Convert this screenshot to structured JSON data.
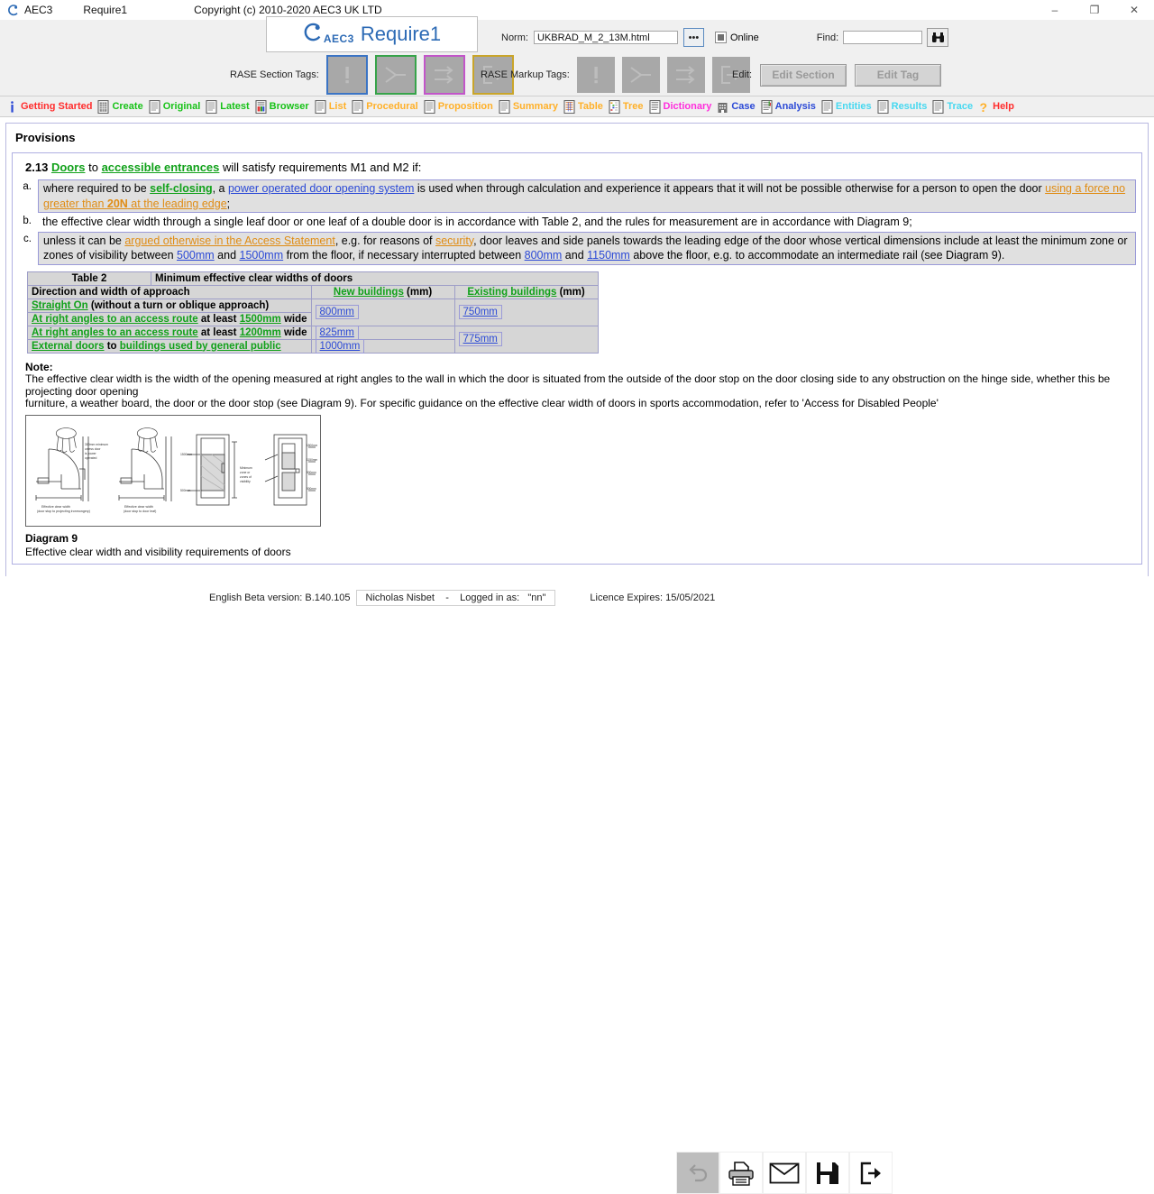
{
  "titlebar": {
    "logo_icon": "aec3-logo-icon",
    "app": "AEC3",
    "document": "Require1",
    "copyright": "Copyright (c) 2010-2020  AEC3 UK LTD",
    "minimize": "–",
    "maximize": "❐",
    "close": "✕"
  },
  "banner": {
    "brand_mark": "◖",
    "brand_aec": "AEC3",
    "brand_name": "Require1",
    "norm_label": "Norm:",
    "norm_value": "UKBRAD_M_2_13M.html",
    "norm_placeholder": "",
    "browse_label": "•••",
    "online_label": "Online",
    "online_checked": true,
    "find_label": "Find:",
    "find_value": "",
    "find_placeholder": "",
    "find_icon": "binoculars-icon"
  },
  "rase": {
    "section_label": "RASE Section Tags:",
    "markup_label": "RASE Markup Tags:",
    "edit_label": "Edit:",
    "section_tags": [
      {
        "name": "requirement-tag",
        "glyph": "exclamation"
      },
      {
        "name": "applies-tag",
        "glyph": "merge"
      },
      {
        "name": "selects-tag",
        "glyph": "double-arrow"
      },
      {
        "name": "exception-tag",
        "glyph": "exit-arrow"
      }
    ],
    "markup_tags": [
      {
        "name": "requirement-markup",
        "glyph": "exclamation"
      },
      {
        "name": "applies-markup",
        "glyph": "merge"
      },
      {
        "name": "selects-markup",
        "glyph": "double-arrow"
      },
      {
        "name": "exception-markup",
        "glyph": "exit-arrow"
      }
    ],
    "edit_section_label": "Edit Section",
    "edit_tag_label": "Edit Tag"
  },
  "nav": {
    "items": [
      {
        "label": "Getting Started",
        "color": "#ff2d2d",
        "icon": "info-icon"
      },
      {
        "label": "Create",
        "color": "#17c217",
        "icon": "document-grid-icon"
      },
      {
        "label": "Original",
        "color": "#17c217",
        "icon": "document-icon"
      },
      {
        "label": "Latest",
        "color": "#17c217",
        "icon": "document-icon"
      },
      {
        "label": "Browser",
        "color": "#17c217",
        "icon": "document-color-icon"
      },
      {
        "label": "List",
        "color": "#ffb028",
        "icon": "document-icon"
      },
      {
        "label": "Procedural",
        "color": "#ffb028",
        "icon": "document-icon"
      },
      {
        "label": "Proposition",
        "color": "#ffb028",
        "icon": "document-icon"
      },
      {
        "label": "Summary",
        "color": "#ffb028",
        "icon": "document-icon"
      },
      {
        "label": "Table",
        "color": "#ffb028",
        "icon": "document-table-icon"
      },
      {
        "label": "Tree",
        "color": "#ffb028",
        "icon": "document-tree-icon"
      },
      {
        "label": "Dictionary",
        "color": "#ff2ddc",
        "icon": "document-list-icon"
      },
      {
        "label": "Case",
        "color": "#2b49d6",
        "icon": "building-icon"
      },
      {
        "label": "Analysis",
        "color": "#2b49d6",
        "icon": "document-analysis-icon"
      },
      {
        "label": "Entities",
        "color": "#46d8f0",
        "icon": "document-icon"
      },
      {
        "label": "Results",
        "color": "#46d8f0",
        "icon": "document-icon"
      },
      {
        "label": "Trace",
        "color": "#46d8f0",
        "icon": "document-icon"
      },
      {
        "label": "Help",
        "color": "#ff2d2d",
        "icon": "question-icon"
      }
    ]
  },
  "content": {
    "section_title": "Provisions",
    "clause_number": "2.13",
    "clause_head_parts": [
      {
        "t": "Doors",
        "s": "g-link"
      },
      {
        "t": " to ",
        "s": "plain"
      },
      {
        "t": "accessible entrances",
        "s": "g-link"
      },
      {
        "t": " will satisfy requirements M1 and M2 if:",
        "s": "plain"
      }
    ],
    "items": [
      {
        "marker": "a.",
        "boxed": true,
        "parts": [
          {
            "t": "where required to be ",
            "s": "plain"
          },
          {
            "t": "self-closing",
            "s": "g-link"
          },
          {
            "t": ", a ",
            "s": "plain"
          },
          {
            "t": "power operated door opening system",
            "s": "b-link"
          },
          {
            "t": " is used when through calculation and experience it appears that it will not be possible otherwise for a person to open the door ",
            "s": "plain"
          },
          {
            "t": "using a force no greater than ",
            "s": "o-link"
          },
          {
            "t": "20N",
            "s": "ob-link"
          },
          {
            "t": " at the leading edge",
            "s": "o-link"
          },
          {
            "t": ";",
            "s": "plain"
          }
        ]
      },
      {
        "marker": "b.",
        "boxed": false,
        "parts": [
          {
            "t": "the effective clear width through a single leaf door or one leaf of a double door is in accordance with Table 2, and the rules for measurement are in accordance with Diagram 9;",
            "s": "plain"
          }
        ]
      },
      {
        "marker": "c.",
        "boxed": true,
        "parts": [
          {
            "t": "unless it can be ",
            "s": "plain"
          },
          {
            "t": "argued otherwise in the Access Statement",
            "s": "o-link"
          },
          {
            "t": ", e.g. for reasons of ",
            "s": "plain"
          },
          {
            "t": "security",
            "s": "o-link"
          },
          {
            "t": ", door leaves and side panels towards the leading edge of the door whose vertical dimensions include at least the minimum zone or zones of visibility between ",
            "s": "plain"
          },
          {
            "t": "500mm",
            "s": "b-link"
          },
          {
            "t": " and ",
            "s": "plain"
          },
          {
            "t": "1500mm",
            "s": "b-link"
          },
          {
            "t": " from the floor, if necessary interrupted between ",
            "s": "plain"
          },
          {
            "t": "800mm",
            "s": "b-link"
          },
          {
            "t": " and ",
            "s": "plain"
          },
          {
            "t": "1150mm",
            "s": "b-link"
          },
          {
            "t": " above the floor, e.g. to accommodate an intermediate rail (see Diagram 9).",
            "s": "plain"
          }
        ]
      }
    ],
    "table": {
      "title": "Table 2",
      "subtitle": "Minimum effective clear widths of doors",
      "header_approach": "Direction and width of approach",
      "header_new_link": "New buildings",
      "header_new_unit": " (mm)",
      "header_existing_link": "Existing buildings",
      "header_existing_unit": " (mm)",
      "rows": [
        {
          "approach_parts": [
            {
              "t": "Straight On",
              "s": "g-link"
            },
            {
              "t": " (without a turn or oblique approach)",
              "s": "bold"
            }
          ],
          "new_value": "800mm",
          "existing_value": "750mm"
        },
        {
          "approach_parts": [
            {
              "t": "At right angles to an access route",
              "s": "g-link"
            },
            {
              "t": " at least ",
              "s": "bold"
            },
            {
              "t": "1500mm",
              "s": "g-link"
            },
            {
              "t": " wide",
              "s": "bold"
            }
          ],
          "new_value": "",
          "existing_value": ""
        },
        {
          "approach_parts": [
            {
              "t": "At right angles to an access route",
              "s": "g-link"
            },
            {
              "t": " at least ",
              "s": "bold"
            },
            {
              "t": "1200mm",
              "s": "g-link"
            },
            {
              "t": " wide",
              "s": "bold"
            }
          ],
          "new_value": "825mm",
          "existing_value": "775mm"
        },
        {
          "approach_parts": [
            {
              "t": "External doors",
              "s": "g-link"
            },
            {
              "t": " to ",
              "s": "bold"
            },
            {
              "t": "buildings used by general public",
              "s": "g-link"
            }
          ],
          "new_value": "1000mm",
          "existing_value": ""
        }
      ]
    },
    "note_label": "Note:",
    "note_line1": "The effective clear width is the width of the opening measured at right angles to the wall in which the door is situated from the outside of the door stop on the door closing side to any obstruction on the hinge side, whether this be projecting door opening",
    "note_line2": "furniture, a weather board, the door or the door stop (see Diagram 9). For specific guidance on the effective clear width of doors in sports accommodation, refer to 'Access for Disabled People'",
    "diagram_name": "door-clear-width-diagram",
    "diagram_label": "Diagram 9",
    "diagram_caption": "Effective clear width and visibility requirements of doors"
  },
  "footer": {
    "version": "English Beta version: B.140.105",
    "user": "Nicholas Nisbet",
    "separator": "-",
    "logged_label": "Logged in as:",
    "logged_value": "\"nn\"",
    "licence": "Licence Expires: 15/05/2021",
    "icons": [
      {
        "name": "undo-icon",
        "disabled": true
      },
      {
        "name": "print-icon",
        "disabled": false
      },
      {
        "name": "mail-icon",
        "disabled": false
      },
      {
        "name": "save-icon",
        "disabled": false
      },
      {
        "name": "exit-icon",
        "disabled": false
      }
    ]
  },
  "colors": {
    "link_green": "#11a11a",
    "link_blue": "#2b49d6",
    "link_orange": "#e08c14",
    "brand_blue": "#2c6ab5",
    "panel_grey": "#f0f0f0"
  }
}
